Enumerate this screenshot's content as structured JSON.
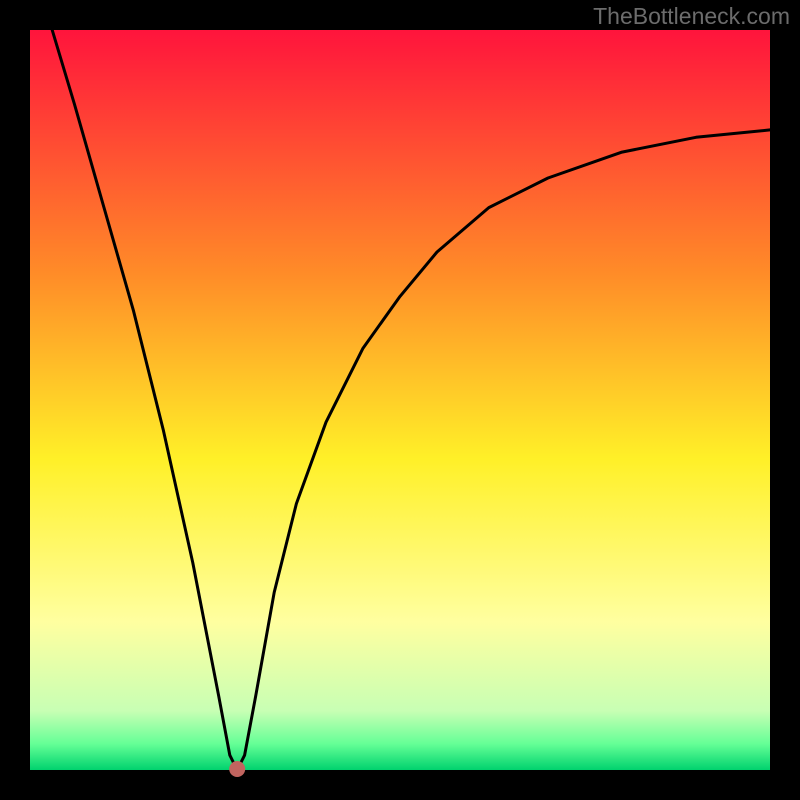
{
  "watermark": {
    "text": "TheBottleneck.com"
  },
  "plot": {
    "x_range": [
      30,
      770
    ],
    "y_range": [
      30,
      770
    ],
    "background_black": true,
    "gradient_stops": [
      {
        "offset": 0.0,
        "color": "#ff143c"
      },
      {
        "offset": 0.33,
        "color": "#ff8c28"
      },
      {
        "offset": 0.58,
        "color": "#fff028"
      },
      {
        "offset": 0.8,
        "color": "#ffffa0"
      },
      {
        "offset": 0.92,
        "color": "#c8ffb4"
      },
      {
        "offset": 0.965,
        "color": "#64ff96"
      },
      {
        "offset": 1.0,
        "color": "#00d26e"
      }
    ],
    "minimum_marker": {
      "x_norm": 0.28,
      "color": "#c1645f",
      "radius": 8
    }
  },
  "chart_data": {
    "type": "line",
    "title": "",
    "xlabel": "",
    "ylabel": "",
    "xlim": [
      0,
      1
    ],
    "ylim": [
      0,
      1
    ],
    "x_min": 0.28,
    "series": [
      {
        "name": "curve",
        "points": [
          {
            "x": 0.03,
            "y": 1.0
          },
          {
            "x": 0.06,
            "y": 0.9
          },
          {
            "x": 0.1,
            "y": 0.76
          },
          {
            "x": 0.14,
            "y": 0.62
          },
          {
            "x": 0.18,
            "y": 0.46
          },
          {
            "x": 0.22,
            "y": 0.28
          },
          {
            "x": 0.255,
            "y": 0.1
          },
          {
            "x": 0.27,
            "y": 0.02
          },
          {
            "x": 0.28,
            "y": 0.0
          },
          {
            "x": 0.29,
            "y": 0.02
          },
          {
            "x": 0.305,
            "y": 0.1
          },
          {
            "x": 0.33,
            "y": 0.24
          },
          {
            "x": 0.36,
            "y": 0.36
          },
          {
            "x": 0.4,
            "y": 0.47
          },
          {
            "x": 0.45,
            "y": 0.57
          },
          {
            "x": 0.5,
            "y": 0.64
          },
          {
            "x": 0.55,
            "y": 0.7
          },
          {
            "x": 0.62,
            "y": 0.76
          },
          {
            "x": 0.7,
            "y": 0.8
          },
          {
            "x": 0.8,
            "y": 0.835
          },
          {
            "x": 0.9,
            "y": 0.855
          },
          {
            "x": 1.0,
            "y": 0.865
          }
        ]
      }
    ]
  }
}
